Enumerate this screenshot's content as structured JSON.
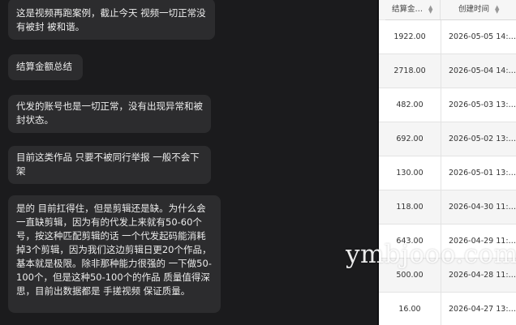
{
  "chat": {
    "messages": [
      {
        "text": "这是视频再跑案例，截止今天 视频一切正常没有被封 被和谐。"
      },
      {
        "text": "结算金额总结"
      },
      {
        "text": "代发的账号也是一切正常，没有出现异常和被封状态。"
      },
      {
        "text": "目前这类作品 只要不被同行举报 一般不会下架"
      },
      {
        "text": "是的 目前扛得住，但是剪辑还是缺。为什么会一直缺剪辑，因为有的代发上来就有50-60个号，按这种匹配剪辑的话 一个代发起码能消耗掉3个剪辑，因为我们这边剪辑日更20个作品，基本就是极限。除非那种能力很强的 一下做50-100个，但是这种50-100个的作品 质量值得深思，目前出数据都是 手搓视频 保证质量。"
      }
    ]
  },
  "table": {
    "headers": {
      "amount": "结算金…",
      "date": "创建时间"
    },
    "rows": [
      {
        "amount": "1922.00",
        "date": "2026-05-05 14:…"
      },
      {
        "amount": "2718.00",
        "date": "2026-05-04 14:…"
      },
      {
        "amount": "482.00",
        "date": "2026-05-03 13:…"
      },
      {
        "amount": "692.00",
        "date": "2026-05-02 13:…"
      },
      {
        "amount": "130.00",
        "date": "2026-05-01 13:…"
      },
      {
        "amount": "118.00",
        "date": "2026-04-30 11:…"
      },
      {
        "amount": "643.00",
        "date": "2026-04-29 11:…"
      },
      {
        "amount": "500.00",
        "date": "2026-04-28 11:…"
      },
      {
        "amount": "16.00",
        "date": "2026-04-27 13:…"
      }
    ]
  },
  "watermark": "ymbjooo.com"
}
